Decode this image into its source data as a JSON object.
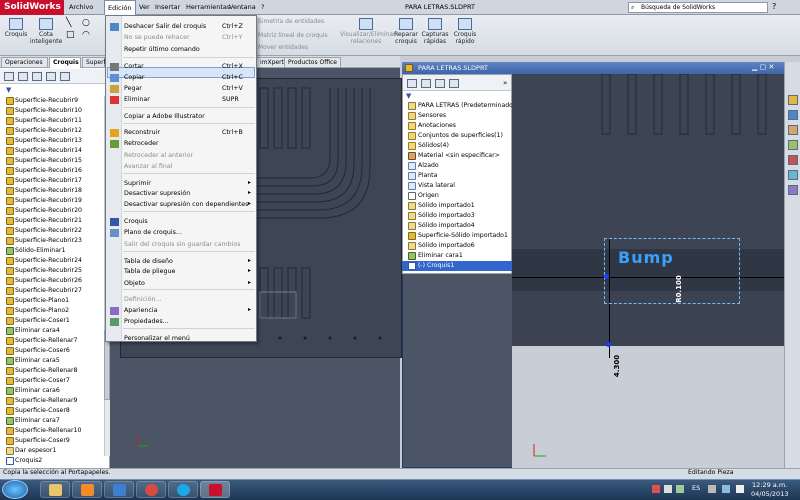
{
  "app": {
    "logo_text": "SolidWorks",
    "document_title": "PARA LETRAS.SLDPRT",
    "search_placeholder": "Búsqueda de SolidWorks",
    "accent_color": "#c8102e"
  },
  "menubar": [
    "Archivo",
    "Edición",
    "Ver",
    "Insertar",
    "Herramientas",
    "Ventana",
    "?"
  ],
  "ribbon": {
    "croquis": "Croquis",
    "cota_line1": "Cota",
    "cota_line2": "inteligente",
    "simetria": "Simetría de entidades",
    "matriz": "Matriz lineal de croquis",
    "mover": "Mover entidades",
    "visualizar_line1": "Visualizar/Eliminar",
    "visualizar_line2": "relaciones",
    "reparar_line1": "Reparar",
    "reparar_line2": "croquis",
    "capturas_line1": "Capturas",
    "capturas_line2": "rápidas",
    "rapido_line1": "Croquis",
    "rapido_line2": "rápido"
  },
  "tabs": [
    "Operaciones",
    "Croquis",
    "Superf"
  ],
  "view_tabs": [
    "imXpert",
    "Productos Office"
  ],
  "edit_menu": [
    {
      "label": "Deshacer Salir del croquis",
      "shortcut": "Ctrl+Z",
      "disabled": false
    },
    {
      "label": "No se puede rehacer",
      "shortcut": "Ctrl+Y",
      "disabled": true
    },
    {
      "label": "Repetir último comando",
      "shortcut": "",
      "disabled": false
    },
    {
      "label": "Cortar",
      "shortcut": "Ctrl+X",
      "disabled": false
    },
    {
      "label": "Copiar",
      "shortcut": "Ctrl+C",
      "disabled": false
    },
    {
      "label": "Pegar",
      "shortcut": "Ctrl+V",
      "disabled": false
    },
    {
      "label": "Eliminar",
      "shortcut": "SUPR",
      "disabled": false
    },
    {
      "label": "Copiar a Adobe Illustrator",
      "shortcut": "",
      "disabled": false
    },
    {
      "label": "Reconstruir",
      "shortcut": "Ctrl+B",
      "disabled": false
    },
    {
      "label": "Retroceder",
      "shortcut": "",
      "disabled": false
    },
    {
      "label": "Retroceder al anterior",
      "shortcut": "",
      "disabled": true
    },
    {
      "label": "Avanzar al final",
      "shortcut": "",
      "disabled": true
    },
    {
      "label": "Suprimir",
      "shortcut": "",
      "disabled": false
    },
    {
      "label": "Desactivar supresión",
      "shortcut": "",
      "disabled": false
    },
    {
      "label": "Desactivar supresión con dependientes",
      "shortcut": "",
      "disabled": false
    },
    {
      "label": "Croquis",
      "shortcut": "",
      "disabled": false
    },
    {
      "label": "Plano de croquis...",
      "shortcut": "",
      "disabled": false
    },
    {
      "label": "Salir del croquis sin guardar cambios",
      "shortcut": "",
      "disabled": true
    },
    {
      "label": "Tabla de diseño",
      "shortcut": "",
      "disabled": false
    },
    {
      "label": "Tabla de pliegue",
      "shortcut": "",
      "disabled": false
    },
    {
      "label": "Objeto",
      "shortcut": "",
      "disabled": false
    },
    {
      "label": "Definición...",
      "shortcut": "",
      "disabled": true
    },
    {
      "label": "Apariencia",
      "shortcut": "",
      "disabled": false
    },
    {
      "label": "Propiedades...",
      "shortcut": "",
      "disabled": false
    },
    {
      "label": "Personalizar el menú",
      "shortcut": "",
      "disabled": false
    }
  ],
  "left_tree": [
    {
      "label": "Superficie-Recubrir9",
      "icon": "surface-loft-icon"
    },
    {
      "label": "Superficie-Recubrir10",
      "icon": "surface-loft-icon"
    },
    {
      "label": "Superficie-Recubrir11",
      "icon": "surface-loft-icon"
    },
    {
      "label": "Superficie-Recubrir12",
      "icon": "surface-loft-icon"
    },
    {
      "label": "Superficie-Recubrir13",
      "icon": "surface-loft-icon"
    },
    {
      "label": "Superficie-Recubrir14",
      "icon": "surface-loft-icon"
    },
    {
      "label": "Superficie-Recubrir15",
      "icon": "surface-loft-icon"
    },
    {
      "label": "Superficie-Recubrir16",
      "icon": "surface-loft-icon"
    },
    {
      "label": "Superficie-Recubrir17",
      "icon": "surface-loft-icon"
    },
    {
      "label": "Superficie-Recubrir18",
      "icon": "surface-loft-icon"
    },
    {
      "label": "Superficie-Recubrir19",
      "icon": "surface-loft-icon"
    },
    {
      "label": "Superficie-Recubrir20",
      "icon": "surface-loft-icon"
    },
    {
      "label": "Superficie-Recubrir21",
      "icon": "surface-loft-icon"
    },
    {
      "label": "Superficie-Recubrir22",
      "icon": "surface-loft-icon"
    },
    {
      "label": "Superficie-Recubrir23",
      "icon": "surface-loft-icon"
    },
    {
      "label": "Sólido-Eliminar1",
      "icon": "delete-body-icon"
    },
    {
      "label": "Superficie-Recubrir24",
      "icon": "surface-loft-icon"
    },
    {
      "label": "Superficie-Recubrir25",
      "icon": "surface-loft-icon"
    },
    {
      "label": "Superficie-Recubrir26",
      "icon": "surface-loft-icon"
    },
    {
      "label": "Superficie-Recubrir27",
      "icon": "surface-loft-icon"
    },
    {
      "label": "Superficie-Plano1",
      "icon": "surface-plane-icon"
    },
    {
      "label": "Superficie-Plano2",
      "icon": "surface-plane-icon"
    },
    {
      "label": "Superficie-Coser1",
      "icon": "surface-knit-icon"
    },
    {
      "label": "Eliminar cara4",
      "icon": "delete-face-icon"
    },
    {
      "label": "Superficie-Rellenar7",
      "icon": "surface-fill-icon"
    },
    {
      "label": "Superficie-Coser6",
      "icon": "surface-knit-icon"
    },
    {
      "label": "Eliminar cara5",
      "icon": "delete-face-icon"
    },
    {
      "label": "Superficie-Rellenar8",
      "icon": "surface-fill-icon"
    },
    {
      "label": "Superficie-Coser7",
      "icon": "surface-knit-icon"
    },
    {
      "label": "Eliminar cara6",
      "icon": "delete-face-icon"
    },
    {
      "label": "Superficie-Rellenar9",
      "icon": "surface-fill-icon"
    },
    {
      "label": "Superficie-Coser8",
      "icon": "surface-knit-icon"
    },
    {
      "label": "Eliminar cara7",
      "icon": "delete-face-icon"
    },
    {
      "label": "Superficie-Rellenar10",
      "icon": "surface-fill-icon"
    },
    {
      "label": "Superficie-Coser9",
      "icon": "surface-knit-icon"
    },
    {
      "label": "Dar espesor1",
      "icon": "thicken-icon"
    },
    {
      "label": "Croquis2",
      "icon": "sketch-icon"
    }
  ],
  "right_window": {
    "title": "PARA LETRAS.SLDPRT",
    "tree": [
      {
        "label": "PARA LETRAS  (Predeterminado<",
        "icon": "part-icon"
      },
      {
        "label": "Sensores",
        "icon": "sensor-folder-icon"
      },
      {
        "label": "Anotaciones",
        "icon": "annotations-icon"
      },
      {
        "label": "Conjuntos de superficies(1)",
        "icon": "surface-bodies-icon"
      },
      {
        "label": "Sólidos(4)",
        "icon": "solid-bodies-icon"
      },
      {
        "label": "Material <sin especificar>",
        "icon": "material-icon"
      },
      {
        "label": "Alzado",
        "icon": "plane-icon"
      },
      {
        "label": "Planta",
        "icon": "plane-icon"
      },
      {
        "label": "Vista lateral",
        "icon": "plane-icon"
      },
      {
        "label": "Origen",
        "icon": "origin-icon"
      },
      {
        "label": "Sólido importado1",
        "icon": "imported-body-icon"
      },
      {
        "label": "Sólido importado3",
        "icon": "imported-body-icon"
      },
      {
        "label": "Sólido importado4",
        "icon": "imported-body-icon"
      },
      {
        "label": "Superficie-Sólido importado1",
        "icon": "imported-surface-icon"
      },
      {
        "label": "Sólido importado6",
        "icon": "imported-body-icon"
      },
      {
        "label": "Eliminar cara1",
        "icon": "delete-face-icon"
      },
      {
        "label": "(-) Croquis1",
        "icon": "sketch-icon"
      }
    ],
    "logo_text": "Bump",
    "dim1": "R0.100",
    "dim2": "4.300"
  },
  "status": {
    "left": "Copia la selección al Portapapeles.",
    "right": "Editando Pieza"
  },
  "taskbar": {
    "lang": "ES",
    "time": "12:29 a.m.",
    "date": "04/05/2013"
  }
}
